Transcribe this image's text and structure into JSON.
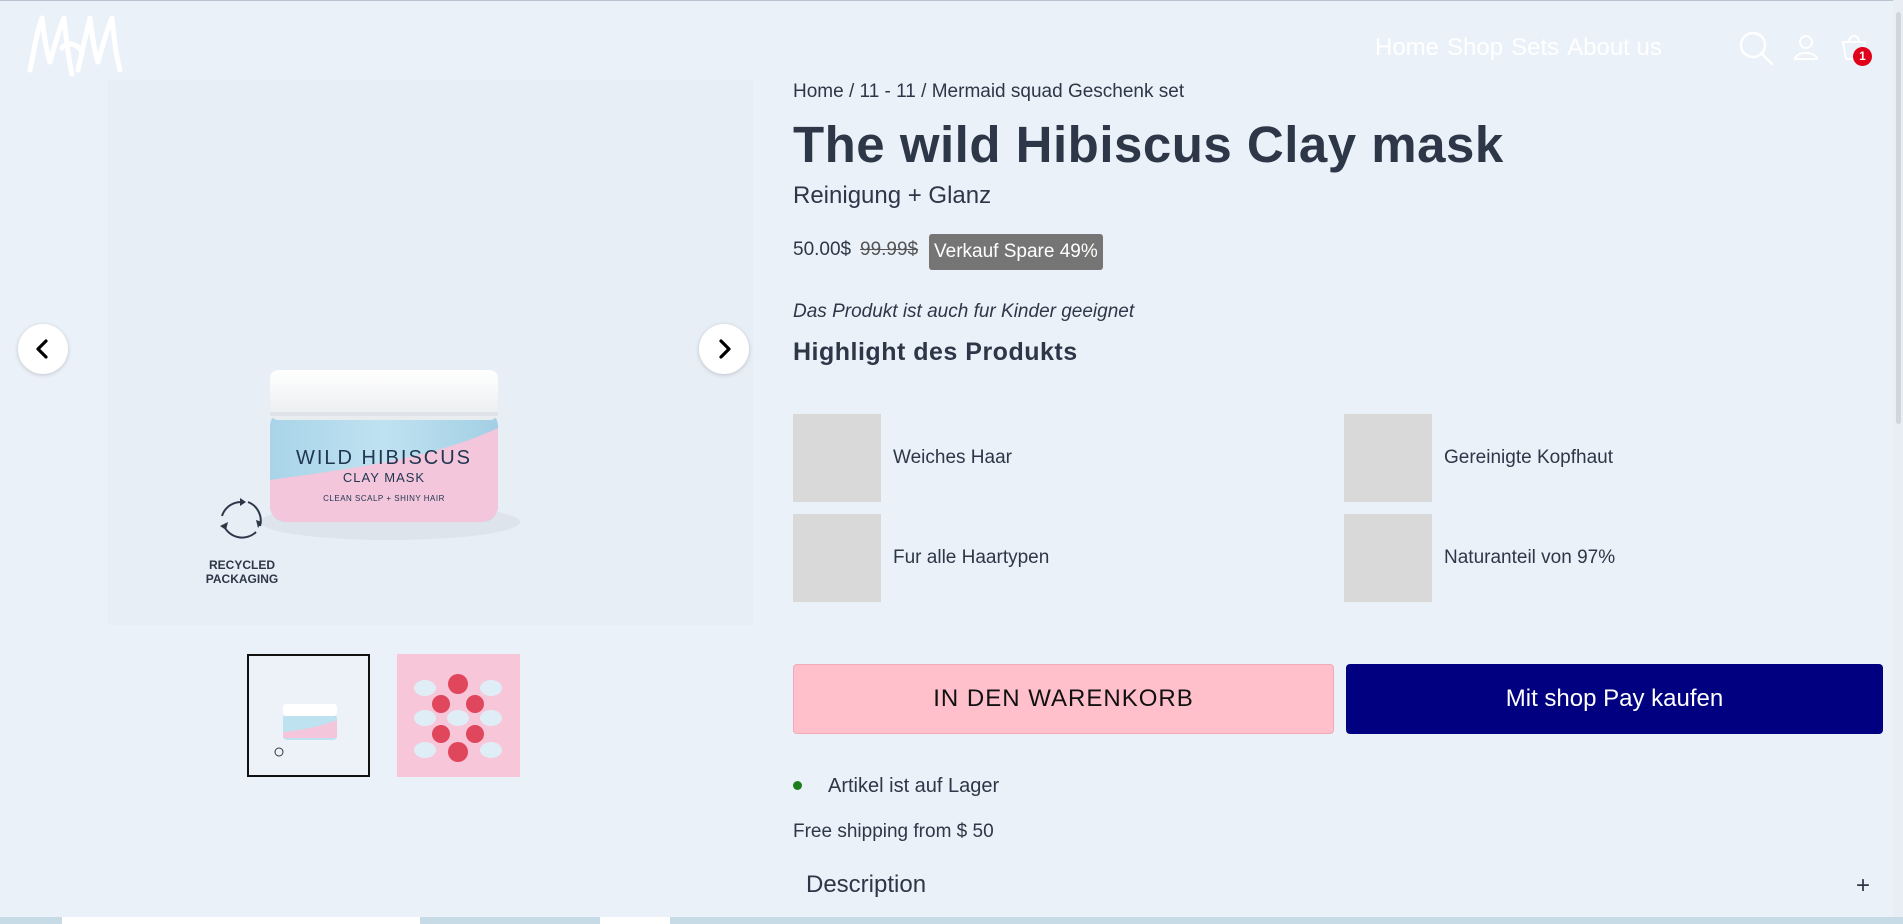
{
  "header": {
    "logo_text": "MM",
    "nav": [
      "Home",
      "Shop",
      "Sets",
      "About us"
    ],
    "icons": [
      "search-icon",
      "user-icon",
      "cart-icon"
    ],
    "cart_count": "1"
  },
  "gallery": {
    "product_label_line1": "WILD HIBISCUS",
    "product_label_line2": "CLAY MASK",
    "product_label_line3": "CLEAN SCALP + SHINY HAIR",
    "recycled_line1": "RECYCLED",
    "recycled_line2": "PACKAGING",
    "thumbnail_count": 2
  },
  "product": {
    "breadcrumb": [
      "Home",
      "11 - 11",
      "Mermaid squad Geschenk set"
    ],
    "breadcrumb_sep": " / ",
    "title": "The wild Hibiscus Clay mask",
    "subtitle": "Reinigung + Glanz",
    "price": "50.00$",
    "old_price": "99.99$",
    "sale_badge": "Verkauf Spare 49%",
    "kids_note": "Das Produkt ist auch fur Kinder geeignet",
    "highlights_heading": "Highlight des Produkts",
    "highlights": [
      "Weiches Haar",
      "Gereinigte Kopfhaut",
      "Fur alle Haartypen",
      "Naturanteil von 97%"
    ],
    "add_to_cart": "IN DEN WARENKORB",
    "shop_pay": "Mit shop Pay kaufen",
    "stock": "Artikel ist auf Lager",
    "shipping": "Free shipping from $ 50",
    "description": "Description",
    "description_toggle": "+"
  },
  "colors": {
    "background": "#ebf1f8",
    "text": "#2d3748",
    "add_to_cart_bg": "#ffc0cb",
    "shop_pay_bg": "#000080",
    "sale_badge_bg": "#757575",
    "in_stock": "#1a7f1a",
    "cart_badge": "#e0001a"
  }
}
